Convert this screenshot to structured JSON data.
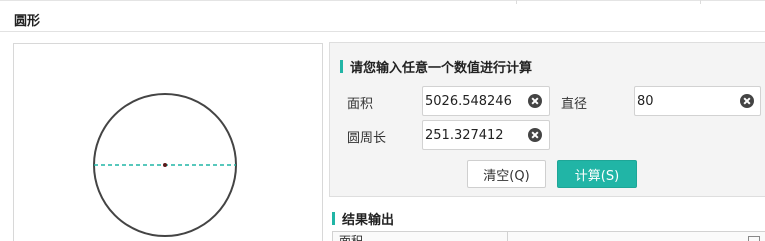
{
  "page": {
    "title": "圆形"
  },
  "figure": {
    "shape": "circle",
    "colors": {
      "circle": "#444444",
      "diameter_line": "#21b5a6",
      "center": "#c0392b"
    }
  },
  "calc": {
    "section_title": "请您输入任意一个数值进行计算",
    "fields": {
      "area": {
        "label": "面积",
        "value": "5026.548246"
      },
      "diameter": {
        "label": "直径",
        "value": "80"
      },
      "circumference": {
        "label": "圆周长",
        "value": "251.327412"
      }
    },
    "buttons": {
      "clear": "清空(Q)",
      "compute": "计算(S)"
    }
  },
  "result": {
    "title": "结果输出",
    "first_row_label": "面积"
  },
  "icons": {
    "clear": "clear-circle-x-icon",
    "copy": "copy-icon"
  },
  "theme": {
    "accent": "#21b5a6"
  }
}
